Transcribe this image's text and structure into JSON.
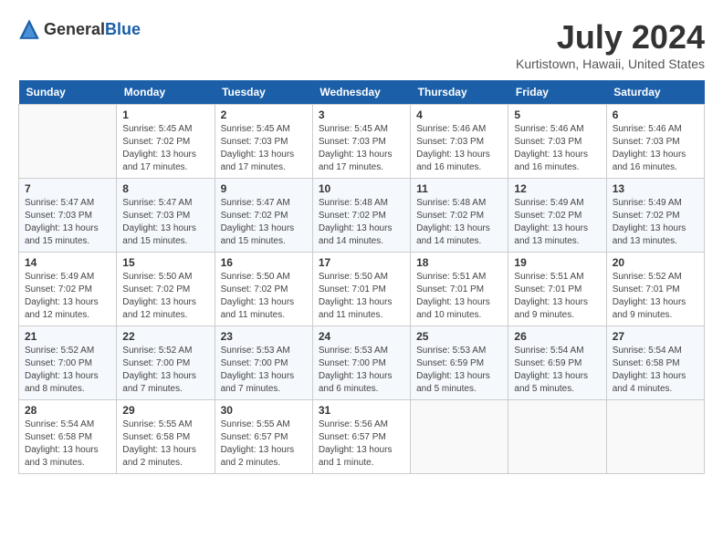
{
  "header": {
    "logo_general": "General",
    "logo_blue": "Blue",
    "title": "July 2024",
    "location": "Kurtistown, Hawaii, United States"
  },
  "calendar": {
    "weekdays": [
      "Sunday",
      "Monday",
      "Tuesday",
      "Wednesday",
      "Thursday",
      "Friday",
      "Saturday"
    ],
    "weeks": [
      [
        {
          "day": "",
          "sunrise": "",
          "sunset": "",
          "daylight": ""
        },
        {
          "day": "1",
          "sunrise": "Sunrise: 5:45 AM",
          "sunset": "Sunset: 7:02 PM",
          "daylight": "Daylight: 13 hours and 17 minutes."
        },
        {
          "day": "2",
          "sunrise": "Sunrise: 5:45 AM",
          "sunset": "Sunset: 7:03 PM",
          "daylight": "Daylight: 13 hours and 17 minutes."
        },
        {
          "day": "3",
          "sunrise": "Sunrise: 5:45 AM",
          "sunset": "Sunset: 7:03 PM",
          "daylight": "Daylight: 13 hours and 17 minutes."
        },
        {
          "day": "4",
          "sunrise": "Sunrise: 5:46 AM",
          "sunset": "Sunset: 7:03 PM",
          "daylight": "Daylight: 13 hours and 16 minutes."
        },
        {
          "day": "5",
          "sunrise": "Sunrise: 5:46 AM",
          "sunset": "Sunset: 7:03 PM",
          "daylight": "Daylight: 13 hours and 16 minutes."
        },
        {
          "day": "6",
          "sunrise": "Sunrise: 5:46 AM",
          "sunset": "Sunset: 7:03 PM",
          "daylight": "Daylight: 13 hours and 16 minutes."
        }
      ],
      [
        {
          "day": "7",
          "sunrise": "Sunrise: 5:47 AM",
          "sunset": "Sunset: 7:03 PM",
          "daylight": "Daylight: 13 hours and 15 minutes."
        },
        {
          "day": "8",
          "sunrise": "Sunrise: 5:47 AM",
          "sunset": "Sunset: 7:03 PM",
          "daylight": "Daylight: 13 hours and 15 minutes."
        },
        {
          "day": "9",
          "sunrise": "Sunrise: 5:47 AM",
          "sunset": "Sunset: 7:02 PM",
          "daylight": "Daylight: 13 hours and 15 minutes."
        },
        {
          "day": "10",
          "sunrise": "Sunrise: 5:48 AM",
          "sunset": "Sunset: 7:02 PM",
          "daylight": "Daylight: 13 hours and 14 minutes."
        },
        {
          "day": "11",
          "sunrise": "Sunrise: 5:48 AM",
          "sunset": "Sunset: 7:02 PM",
          "daylight": "Daylight: 13 hours and 14 minutes."
        },
        {
          "day": "12",
          "sunrise": "Sunrise: 5:49 AM",
          "sunset": "Sunset: 7:02 PM",
          "daylight": "Daylight: 13 hours and 13 minutes."
        },
        {
          "day": "13",
          "sunrise": "Sunrise: 5:49 AM",
          "sunset": "Sunset: 7:02 PM",
          "daylight": "Daylight: 13 hours and 13 minutes."
        }
      ],
      [
        {
          "day": "14",
          "sunrise": "Sunrise: 5:49 AM",
          "sunset": "Sunset: 7:02 PM",
          "daylight": "Daylight: 13 hours and 12 minutes."
        },
        {
          "day": "15",
          "sunrise": "Sunrise: 5:50 AM",
          "sunset": "Sunset: 7:02 PM",
          "daylight": "Daylight: 13 hours and 12 minutes."
        },
        {
          "day": "16",
          "sunrise": "Sunrise: 5:50 AM",
          "sunset": "Sunset: 7:02 PM",
          "daylight": "Daylight: 13 hours and 11 minutes."
        },
        {
          "day": "17",
          "sunrise": "Sunrise: 5:50 AM",
          "sunset": "Sunset: 7:01 PM",
          "daylight": "Daylight: 13 hours and 11 minutes."
        },
        {
          "day": "18",
          "sunrise": "Sunrise: 5:51 AM",
          "sunset": "Sunset: 7:01 PM",
          "daylight": "Daylight: 13 hours and 10 minutes."
        },
        {
          "day": "19",
          "sunrise": "Sunrise: 5:51 AM",
          "sunset": "Sunset: 7:01 PM",
          "daylight": "Daylight: 13 hours and 9 minutes."
        },
        {
          "day": "20",
          "sunrise": "Sunrise: 5:52 AM",
          "sunset": "Sunset: 7:01 PM",
          "daylight": "Daylight: 13 hours and 9 minutes."
        }
      ],
      [
        {
          "day": "21",
          "sunrise": "Sunrise: 5:52 AM",
          "sunset": "Sunset: 7:00 PM",
          "daylight": "Daylight: 13 hours and 8 minutes."
        },
        {
          "day": "22",
          "sunrise": "Sunrise: 5:52 AM",
          "sunset": "Sunset: 7:00 PM",
          "daylight": "Daylight: 13 hours and 7 minutes."
        },
        {
          "day": "23",
          "sunrise": "Sunrise: 5:53 AM",
          "sunset": "Sunset: 7:00 PM",
          "daylight": "Daylight: 13 hours and 7 minutes."
        },
        {
          "day": "24",
          "sunrise": "Sunrise: 5:53 AM",
          "sunset": "Sunset: 7:00 PM",
          "daylight": "Daylight: 13 hours and 6 minutes."
        },
        {
          "day": "25",
          "sunrise": "Sunrise: 5:53 AM",
          "sunset": "Sunset: 6:59 PM",
          "daylight": "Daylight: 13 hours and 5 minutes."
        },
        {
          "day": "26",
          "sunrise": "Sunrise: 5:54 AM",
          "sunset": "Sunset: 6:59 PM",
          "daylight": "Daylight: 13 hours and 5 minutes."
        },
        {
          "day": "27",
          "sunrise": "Sunrise: 5:54 AM",
          "sunset": "Sunset: 6:58 PM",
          "daylight": "Daylight: 13 hours and 4 minutes."
        }
      ],
      [
        {
          "day": "28",
          "sunrise": "Sunrise: 5:54 AM",
          "sunset": "Sunset: 6:58 PM",
          "daylight": "Daylight: 13 hours and 3 minutes."
        },
        {
          "day": "29",
          "sunrise": "Sunrise: 5:55 AM",
          "sunset": "Sunset: 6:58 PM",
          "daylight": "Daylight: 13 hours and 2 minutes."
        },
        {
          "day": "30",
          "sunrise": "Sunrise: 5:55 AM",
          "sunset": "Sunset: 6:57 PM",
          "daylight": "Daylight: 13 hours and 2 minutes."
        },
        {
          "day": "31",
          "sunrise": "Sunrise: 5:56 AM",
          "sunset": "Sunset: 6:57 PM",
          "daylight": "Daylight: 13 hours and 1 minute."
        },
        {
          "day": "",
          "sunrise": "",
          "sunset": "",
          "daylight": ""
        },
        {
          "day": "",
          "sunrise": "",
          "sunset": "",
          "daylight": ""
        },
        {
          "day": "",
          "sunrise": "",
          "sunset": "",
          "daylight": ""
        }
      ]
    ]
  }
}
